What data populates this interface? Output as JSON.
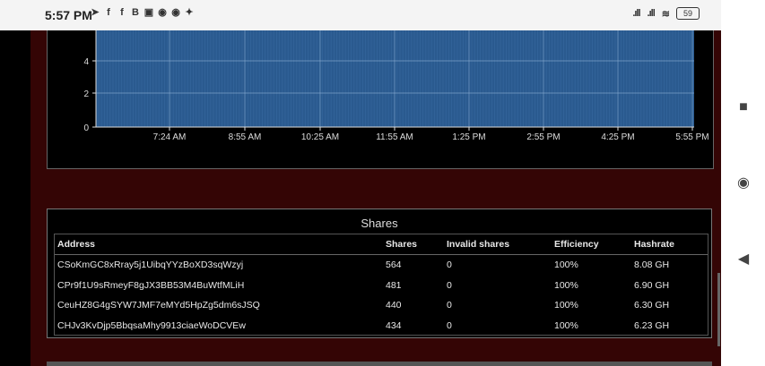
{
  "status_bar": {
    "time": "5:57 PM",
    "notification_icons": [
      "navigation-icon",
      "facebook-icon",
      "facebook-icon",
      "bold-b-icon",
      "gallery-icon",
      "chrome-icon",
      "chrome-icon",
      "twitter-icon"
    ],
    "battery": "59"
  },
  "chart": {
    "y_ticks": [
      "4",
      "2",
      "0"
    ],
    "x_ticks": [
      "7:24 AM",
      "8:55 AM",
      "10:25 AM",
      "11:55 AM",
      "1:25 PM",
      "2:55 PM",
      "4:25 PM",
      "5:55 PM"
    ],
    "fill_color": "#2a5a8f"
  },
  "shares": {
    "title": "Shares",
    "columns": [
      "Address",
      "Shares",
      "Invalid shares",
      "Efficiency",
      "Hashrate"
    ],
    "rows": [
      [
        "CSoKmGC8xRray5j1UibqYYzBoXD3sqWzyj",
        "564",
        "0",
        "100%",
        "8.08 GH"
      ],
      [
        "CPr9f1U9sRmeyF8gJX3BB53M4BuWtfMLiH",
        "481",
        "0",
        "100%",
        "6.90 GH"
      ],
      [
        "CeuHZ8G4gSYW7JMF7eMYd5HpZg5dm6sJSQ",
        "440",
        "0",
        "100%",
        "6.30 GH"
      ],
      [
        "CHJv3KvDjp5BbqsaMhy9913ciaeWoDCVEw",
        "434",
        "0",
        "100%",
        "6.23 GH"
      ]
    ]
  },
  "nav": {
    "recents": "■",
    "home": "◉",
    "back": "◀"
  }
}
